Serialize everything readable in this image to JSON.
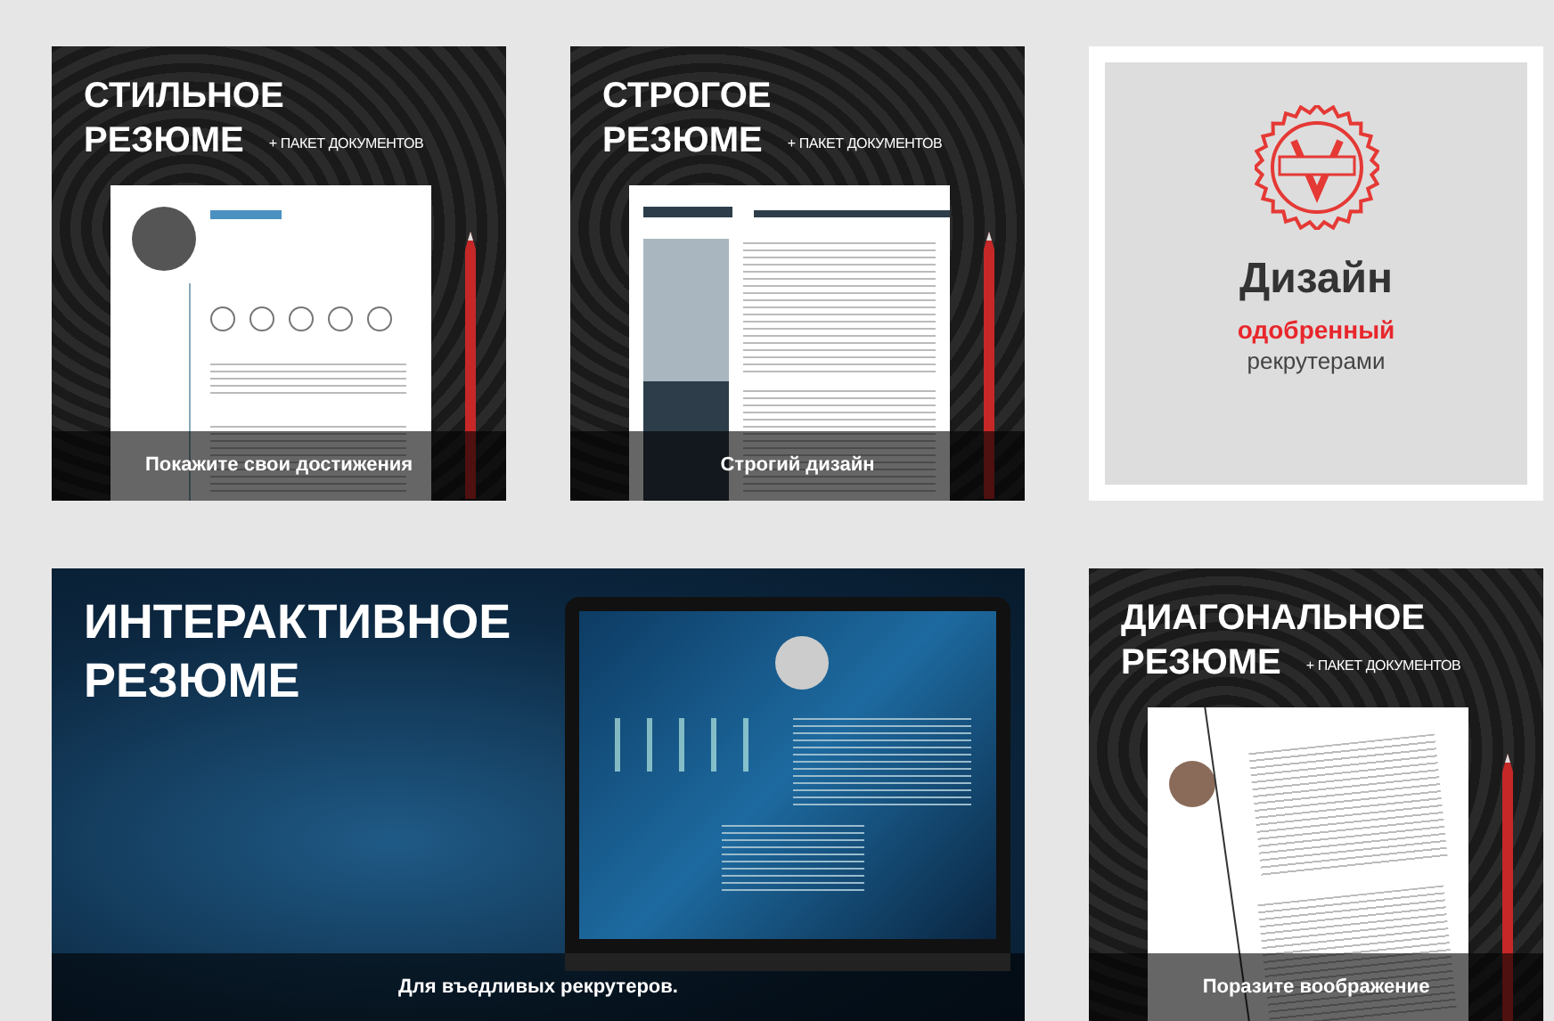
{
  "cards": [
    {
      "kind": "template",
      "title_lines": [
        "СТИЛЬНОЕ",
        "РЕЗЮМЕ"
      ],
      "badge": "+ ПАКЕТ ДОКУМЕНТОВ",
      "caption": "Покажите свои достижения",
      "preview": {
        "kind": "circle"
      }
    },
    {
      "kind": "template",
      "title_lines": [
        "СТРОГОЕ",
        "РЕЗЮМЕ"
      ],
      "badge": "+ ПАКЕТ ДОКУМЕНТОВ",
      "caption": "Строгий дизайн",
      "preview": {
        "kind": "sidebar"
      }
    },
    {
      "kind": "promo",
      "heading": "Дизайн",
      "highlight": "одобренный",
      "subtext": "рекрутерами"
    },
    {
      "kind": "interactive",
      "title_lines": [
        "ИНТЕРАКТИВНОЕ",
        "РЕЗЮМЕ"
      ],
      "caption": "Для въедливых рекрутеров."
    },
    {
      "kind": "template",
      "title_lines": [
        "ДИАГОНАЛЬНОЕ",
        "РЕЗЮМЕ"
      ],
      "badge": "+ ПАКЕТ ДОКУМЕНТОВ",
      "caption": "Поразите воображение",
      "preview": {
        "kind": "diagonal"
      }
    }
  ]
}
